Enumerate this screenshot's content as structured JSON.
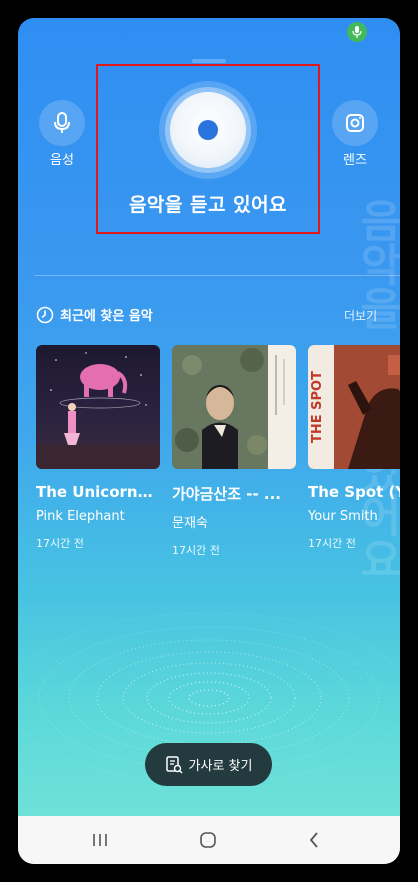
{
  "status_bar": {
    "mic_indicator_color": "#43b85c",
    "icon": "mic-icon"
  },
  "left_action": {
    "icon": "mic-icon",
    "label": "음성"
  },
  "right_action": {
    "icon": "lens-icon",
    "label": "렌즈"
  },
  "listening": {
    "status": "음악을 듣고 있어요",
    "icon": "listening-disc-icon"
  },
  "watermark_text": "음악을 듣고 있어요",
  "recent": {
    "icon": "history-icon",
    "title": "최근에 찾은 음악",
    "more_label": "더보기",
    "items": [
      {
        "title": "The Unicorns ...",
        "artist": "Pink Elephant",
        "time": "17시간 전"
      },
      {
        "title": "가야금산조 -- ...",
        "artist": "문재숙",
        "time": "17시간 전"
      },
      {
        "title": "The Spot (Yo",
        "artist": "Your Smith",
        "time": "17시간 전"
      }
    ]
  },
  "lyrics_button": {
    "icon": "lyrics-search-icon",
    "label": "가사로 찾기"
  },
  "nav": {
    "recent_apps": "recent-apps-icon",
    "home": "home-icon",
    "back": "back-icon"
  },
  "colors": {
    "accent_blue": "#2f8ef2",
    "highlight_red": "#e0181b",
    "lyrics_btn_bg": "#233a3e"
  }
}
